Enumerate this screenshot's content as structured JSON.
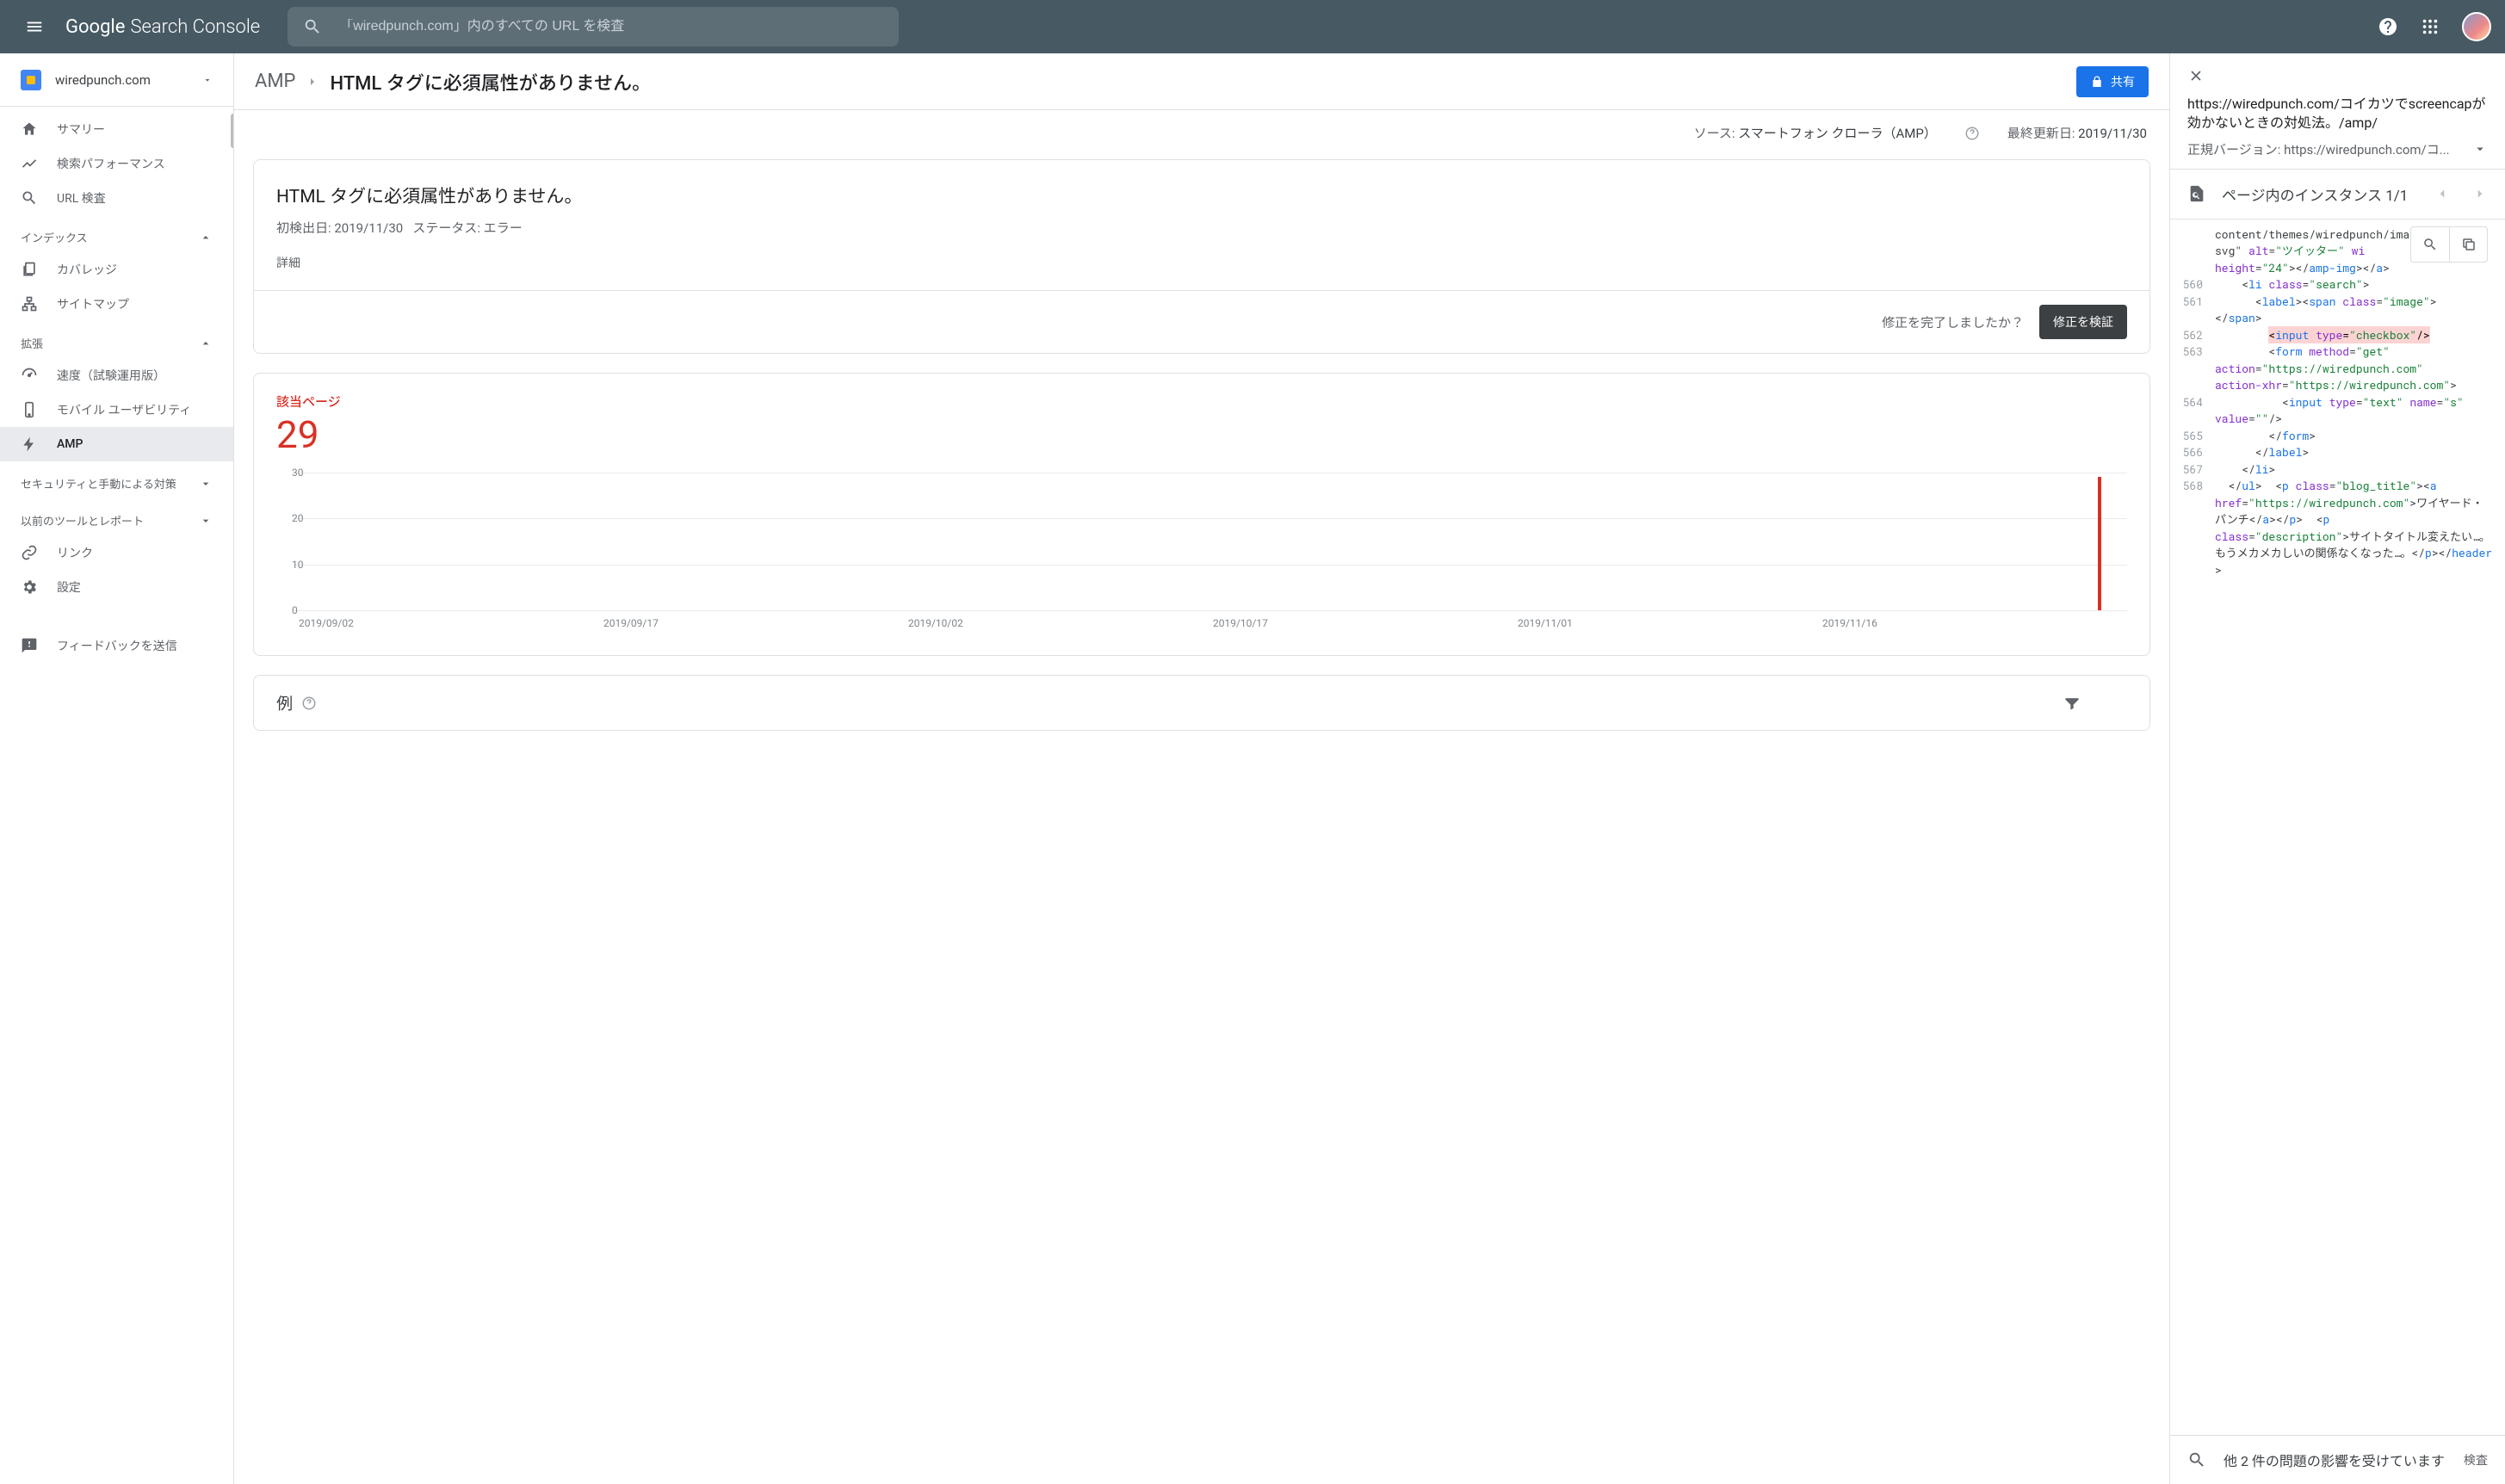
{
  "header": {
    "product_g": "Google",
    "product_sc": "Search Console",
    "search_placeholder": "「wiredpunch.com」内のすべての URL を検査"
  },
  "sidebar": {
    "property": "wiredpunch.com",
    "items": [
      {
        "label": "サマリー"
      },
      {
        "label": "検索パフォーマンス"
      },
      {
        "label": "URL 検査"
      }
    ],
    "section_index": "インデックス",
    "index_items": [
      {
        "label": "カバレッジ"
      },
      {
        "label": "サイトマップ"
      }
    ],
    "section_enh": "拡張",
    "enh_items": [
      {
        "label": "速度（試験運用版）"
      },
      {
        "label": "モバイル ユーザビリティ"
      },
      {
        "label": "AMP"
      }
    ],
    "section_sec": "セキュリティと手動による対策",
    "section_old": "以前のツールとレポート",
    "link": "リンク",
    "settings": "設定",
    "feedback": "フィードバックを送信"
  },
  "topbar": {
    "crumb1": "AMP",
    "crumb2": "HTML タグに必須属性がありません。",
    "share": "共有"
  },
  "meta": {
    "source_label": "ソース: ",
    "source_value": "スマートフォン クローラ（AMP）",
    "updated_label": "最終更新日: ",
    "updated_value": "2019/11/30"
  },
  "card1": {
    "title": "HTML タグに必須属性がありません。",
    "first_detected": "初検出日: 2019/11/30",
    "status": "ステータス: エラー",
    "detail": "詳細",
    "done_q": "修正を完了しましたか？",
    "validate": "修正を検証"
  },
  "card2": {
    "label": "該当ページ",
    "count": "29"
  },
  "card3": {
    "title": "例"
  },
  "chart_data": {
    "type": "bar",
    "title": "該当ページ",
    "xlabel": "",
    "ylabel": "",
    "ylim": [
      0,
      30
    ],
    "yticks": [
      0,
      10,
      20,
      30
    ],
    "categories": [
      "2019/09/02",
      "2019/09/17",
      "2019/10/02",
      "2019/10/17",
      "2019/11/01",
      "2019/11/16"
    ],
    "series": [
      {
        "name": "該当ページ",
        "color": "#d93025",
        "values_at_ticks": [
          0,
          0,
          0,
          0,
          0,
          0
        ]
      }
    ],
    "data_points": [
      {
        "date": "2019/11/30",
        "value": 29
      }
    ]
  },
  "right": {
    "url": "https://wiredpunch.com/コイカツでscreencapが効かないときの対処法。/amp/",
    "canonical_label": "正規バージョン: ",
    "canonical_value": "https://wiredpunch.com/コ...",
    "instances_label": "ページ内のインスタンス 1/1",
    "footer_label": "他 2 件の問題の影響を受けています",
    "footer_link": "検査",
    "code": [
      {
        "n": "",
        "html": "content/themes/wiredpunch/images/twitter.svg\" <span class=a>alt</span>=<span class=v>\"ツイッター\"</span> <span class=a>wi</span>"
      },
      {
        "n": "",
        "html": "<span class=a>height</span>=<span class=v>\"24\"</span>&gt;&lt;/<span class=t>amp-img</span>&gt;&lt;/<span class=t>a</span>&gt;"
      },
      {
        "n": "560",
        "html": "&nbsp;&nbsp;&nbsp;&nbsp;&lt;<span class=t>li</span> <span class=a>class</span>=<span class=v>\"search\"</span>&gt;"
      },
      {
        "n": "561",
        "html": "&nbsp;&nbsp;&nbsp;&nbsp;&nbsp;&nbsp;&lt;<span class=t>label</span>&gt;&lt;<span class=t>span</span> <span class=a>class</span>=<span class=v>\"image\"</span>&gt;"
      },
      {
        "n": "",
        "html": "&lt;/<span class=t>span</span>&gt;"
      },
      {
        "n": "562",
        "html": "&nbsp;&nbsp;&nbsp;&nbsp;&nbsp;&nbsp;&nbsp;&nbsp;<mark>&lt;<span class=t>input</span> <span class=a>type</span>=<span class=v>\"checkbox\"</span>/&gt;</mark>"
      },
      {
        "n": "563",
        "html": "&nbsp;&nbsp;&nbsp;&nbsp;&nbsp;&nbsp;&nbsp;&nbsp;&lt;<span class=t>form</span> <span class=a>method</span>=<span class=v>\"get\"</span>"
      },
      {
        "n": "",
        "html": "<span class=a>action</span>=<span class=v>\"https://wiredpunch.com\"</span>"
      },
      {
        "n": "",
        "html": "<span class=a>action-xhr</span>=<span class=v>\"https://wiredpunch.com\"</span>&gt;"
      },
      {
        "n": "564",
        "html": "&nbsp;&nbsp;&nbsp;&nbsp;&nbsp;&nbsp;&nbsp;&nbsp;&nbsp;&nbsp;&lt;<span class=t>input</span> <span class=a>type</span>=<span class=v>\"text\"</span> <span class=a>name</span>=<span class=v>\"s\"</span>"
      },
      {
        "n": "",
        "html": "<span class=a>value</span>=<span class=v>\"\"</span>/&gt;"
      },
      {
        "n": "565",
        "html": "&nbsp;&nbsp;&nbsp;&nbsp;&nbsp;&nbsp;&nbsp;&nbsp;&lt;/<span class=t>form</span>&gt;"
      },
      {
        "n": "566",
        "html": "&nbsp;&nbsp;&nbsp;&nbsp;&nbsp;&nbsp;&lt;/<span class=t>label</span>&gt;"
      },
      {
        "n": "567",
        "html": "&nbsp;&nbsp;&nbsp;&nbsp;&lt;/<span class=t>li</span>&gt;"
      },
      {
        "n": "568",
        "html": "&nbsp;&nbsp;&lt;/<span class=t>ul</span>&gt;&nbsp;&nbsp;&lt;<span class=t>p</span> <span class=a>class</span>=<span class=v>\"blog_title\"</span>&gt;&lt;<span class=t>a</span>"
      },
      {
        "n": "",
        "html": "<span class=a>href</span>=<span class=v>\"https://wiredpunch.com\"</span>&gt;ワイヤード・パンチ&lt;/<span class=t>a</span>&gt;&lt;/<span class=t>p</span>&gt;&nbsp;&nbsp;&lt;<span class=t>p</span>"
      },
      {
        "n": "",
        "html": "<span class=a>class</span>=<span class=v>\"description\"</span>&gt;サイトタイトル変えたい…。もうメカメカしいの関係なくなった…。&lt;/<span class=t>p</span>&gt;&lt;/<span class=t>header</span>&gt;"
      }
    ]
  }
}
